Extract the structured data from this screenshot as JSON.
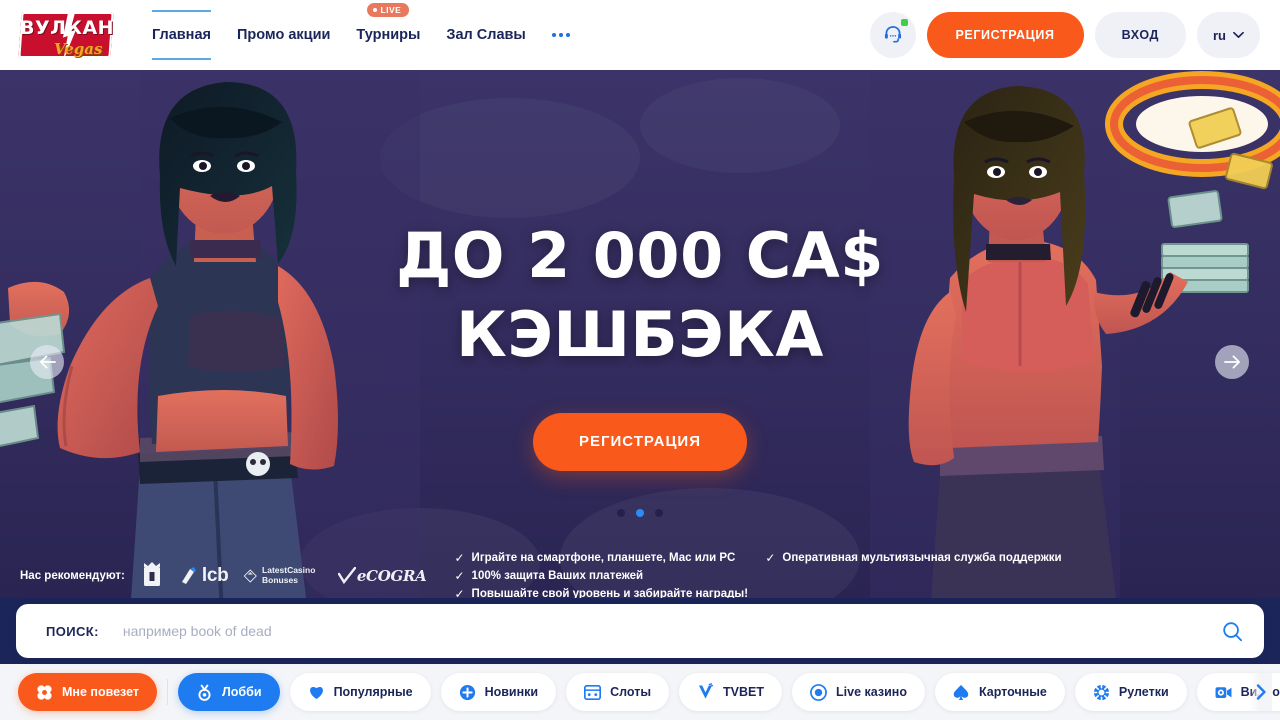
{
  "brand": {
    "logo_main": "ВУЛКАН",
    "logo_sub": "Vegas"
  },
  "nav": {
    "items": [
      {
        "label": "Главная",
        "active": true,
        "badge": null
      },
      {
        "label": "Промо акции",
        "active": false,
        "badge": null
      },
      {
        "label": "Турниры",
        "active": false,
        "badge": "LIVE"
      },
      {
        "label": "Зал Славы",
        "active": false,
        "badge": null
      }
    ],
    "more_label": "•••"
  },
  "header": {
    "support_icon": "headset-icon",
    "register_label": "РЕГИСТРАЦИЯ",
    "login_label": "ВХОД",
    "language": "ru",
    "accent_orange": "#f9591a",
    "accent_blue": "#1f7cf0",
    "navy": "#1b2559"
  },
  "hero": {
    "title_line1": "ДО 2 000 CA$",
    "title_line2": "КЭШБЭКА",
    "cta_label": "РЕГИСТРАЦИЯ",
    "slide_count": 3,
    "active_slide": 2,
    "prev_icon": "arrow-left-icon",
    "next_icon": "arrow-right-icon",
    "bg_color": "#332c5e"
  },
  "trust": {
    "label": "Нас рекомендуют:",
    "logos": [
      {
        "name": "askgamblers-icon",
        "text": ""
      },
      {
        "name": "lcb-logo",
        "text": "lcb"
      },
      {
        "name": "latestcasinobonuses-logo",
        "text": "LatestCasino Bonuses"
      },
      {
        "name": "ecogra-logo",
        "text": "eCOGRA"
      }
    ],
    "features": [
      "Играйте на смартфоне, планшете, Мас или PC",
      "Оперативная мультиязычная служба поддержки",
      "100% защита Ваших платежей",
      "Повышайте свой уровень и забирайте награды!"
    ]
  },
  "search": {
    "label": "ПОИСК:",
    "value": "",
    "placeholder": "например book of dead",
    "icon": "search-icon"
  },
  "categories": {
    "items": [
      {
        "label": "Мне повезет",
        "icon": "clover-icon",
        "style": "lucky"
      },
      {
        "label": "Лобби",
        "icon": "medal-icon",
        "style": "lobby"
      },
      {
        "label": "Популярные",
        "icon": "heart-icon",
        "style": "plain"
      },
      {
        "label": "Новинки",
        "icon": "plus-circle-icon",
        "style": "plain"
      },
      {
        "label": "Слоты",
        "icon": "slot-machine-icon",
        "style": "plain"
      },
      {
        "label": "TVBET",
        "icon": "tvbet-icon",
        "style": "plain"
      },
      {
        "label": "Live казино",
        "icon": "target-icon",
        "style": "plain"
      },
      {
        "label": "Карточные",
        "icon": "spade-icon",
        "style": "plain"
      },
      {
        "label": "Рулетки",
        "icon": "roulette-icon",
        "style": "plain"
      },
      {
        "label": "Видеопокеры",
        "icon": "video-poker-icon",
        "style": "plain"
      }
    ],
    "next_icon": "chevron-right-icon"
  }
}
